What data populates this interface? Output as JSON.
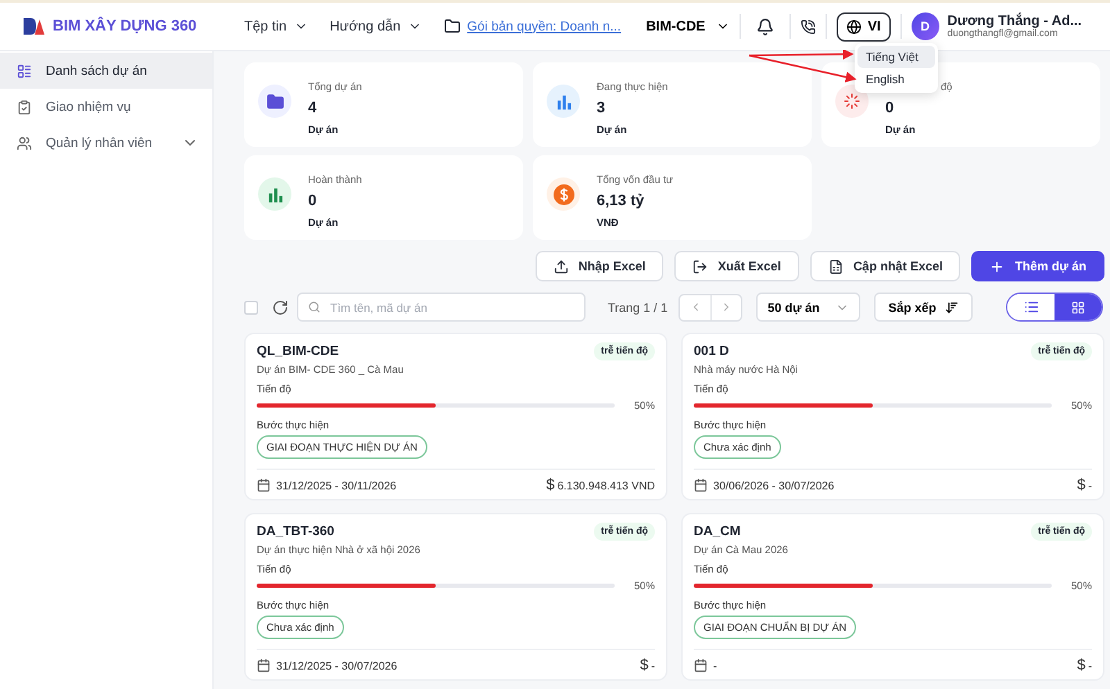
{
  "app": {
    "logo": "BIM XÂY DỰNG 360"
  },
  "menu": [
    {
      "label": "Tệp tin"
    },
    {
      "label": "Hướng dẫn"
    }
  ],
  "license_link": "Gói bản quyền: Doanh n...",
  "workspace": "BIM-CDE",
  "language": {
    "code": "VI",
    "open": true,
    "options": [
      {
        "label": "Tiếng Việt",
        "selected": true
      },
      {
        "label": "English",
        "selected": false
      }
    ]
  },
  "user": {
    "initial": "D",
    "name": "Dương Thắng - Ad...",
    "email": "duongthangfl@gmail.com"
  },
  "sidebar": {
    "items": [
      {
        "label": "Danh sách dự án",
        "selected": true,
        "kind": "list"
      },
      {
        "label": "Giao nhiệm vụ",
        "selected": false,
        "kind": "task"
      },
      {
        "label": "Quản lý nhân viên",
        "selected": false,
        "kind": "people",
        "expanded": false
      }
    ]
  },
  "stats": [
    {
      "label": "Tổng dự án",
      "value": "4",
      "unit": "Dự án",
      "kind": "folder"
    },
    {
      "label": "Đang thực hiện",
      "value": "3",
      "unit": "Dự án",
      "kind": "active"
    },
    {
      "label": "độ",
      "value": "0",
      "unit": "Dự án",
      "kind": "late",
      "covered": true
    },
    {
      "label": "Hoàn thành",
      "value": "0",
      "unit": "Dự án",
      "kind": "done"
    },
    {
      "label": "Tổng vốn đầu tư",
      "value": "6,13 tỷ",
      "unit": "VNĐ",
      "kind": "money"
    }
  ],
  "actions": [
    {
      "label": "Nhập Excel",
      "kind": "import"
    },
    {
      "label": "Xuất Excel",
      "kind": "export"
    },
    {
      "label": "Cập nhật Excel",
      "kind": "update"
    },
    {
      "label": "Thêm dự án",
      "kind": "add"
    }
  ],
  "toolbar": {
    "select_all_checked": false,
    "search_placeholder": "Tìm tên, mã dự án",
    "page": "Trang 1 / 1",
    "page_size": "50 dự án",
    "sort": "Sắp xếp",
    "views": [
      {
        "kind": "list",
        "selected": false
      },
      {
        "kind": "grid",
        "selected": true
      }
    ]
  },
  "projects": [
    {
      "code": "QL_BIM-CDE",
      "name": "Dự án BIM- CDE 360 _ Cà Mau",
      "status": "trễ tiến độ",
      "progress_label": "Tiến độ",
      "level": 0.5,
      "percent": "50%",
      "step_label": "Bước thực hiện",
      "step": "GIAI ĐOẠN THỰC HIỆN DỰ ÁN",
      "dates": "31/12/2025 - 30/11/2026",
      "currency": "$",
      "budget": "6.130.948.413 VND"
    },
    {
      "code": "001 D",
      "name": "Nhà máy nước Hà Nội",
      "status": "trễ tiến độ",
      "progress_label": "Tiến độ",
      "level": 0.5,
      "percent": "50%",
      "step_label": "Bước thực hiện",
      "step": "Chưa xác định",
      "dates": "30/06/2026 - 30/07/2026",
      "currency": "$",
      "budget": "-"
    },
    {
      "code": "DA_TBT-360",
      "name": "Dự án thực hiện Nhà ở xã hội 2026",
      "status": "trễ tiến độ",
      "progress_label": "Tiến độ",
      "level": 0.5,
      "percent": "50%",
      "step_label": "Bước thực hiện",
      "step": "Chưa xác định",
      "dates": "31/12/2025 - 30/07/2026",
      "currency": "$",
      "budget": "-"
    },
    {
      "code": "DA_CM",
      "name": "Dự án Cà Mau 2026",
      "status": "trễ tiến độ",
      "progress_label": "Tiến độ",
      "level": 0.5,
      "percent": "50%",
      "step_label": "Bước thực hiện",
      "step": "GIAI ĐOẠN CHUẨN BỊ DỰ ÁN",
      "dates": "-",
      "currency": "$",
      "budget": "-"
    }
  ]
}
